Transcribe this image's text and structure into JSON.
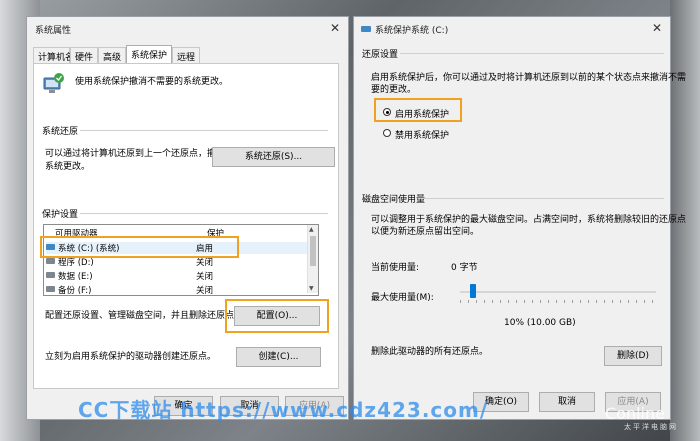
{
  "left_window": {
    "title": "系统属性",
    "tabs": [
      "计算机名",
      "硬件",
      "高级",
      "系统保护",
      "远程"
    ],
    "intro": "使用系统保护撤消不需要的系统更改。",
    "restore_heading": "系统还原",
    "restore_desc_1": "可以通过将计算机还原到上一个还原点，撤消",
    "restore_desc_2": "系统更改。",
    "restore_button": "系统还原(S)...",
    "protection_heading": "保护设置",
    "col_drives": "可用驱动器",
    "col_protection": "保护",
    "drives": [
      {
        "name": "系统 (C:) (系统)",
        "protection": "启用"
      },
      {
        "name": "程序 (D:)",
        "protection": "关闭"
      },
      {
        "name": "数据 (E:)",
        "protection": "关闭"
      },
      {
        "name": "备份 (F:)",
        "protection": "关闭"
      }
    ],
    "config_desc": "配置还原设置、管理磁盘空间，并且删除还原点。",
    "config_button": "配置(O)...",
    "create_desc": "立刻为启用系统保护的驱动器创建还原点。",
    "create_button": "创建(C)...",
    "ok": "确定",
    "cancel": "取消",
    "apply": "应用(A)"
  },
  "right_window": {
    "title": "系统保护系统 (C:)",
    "restore_heading": "还原设置",
    "restore_desc_1": "启用系统保护后，你可以通过及时将计算机还原到以前的某个状态点来撤消不需",
    "restore_desc_2": "要的更改。",
    "radio_on": "启用系统保护",
    "radio_off": "禁用系统保护",
    "disk_heading": "磁盘空间使用量",
    "disk_desc_1": "可以调整用于系统保护的最大磁盘空间。占满空间时，系统将删除较旧的还原点",
    "disk_desc_2": "以便为新还原点留出空间。",
    "current_label": "当前使用量:",
    "current_value": "0 字节",
    "max_label": "最大使用量(M):",
    "slider_fraction": 0.05,
    "max_value": "10% (10.00 GB)",
    "delete_desc": "删除此驱动器的所有还原点。",
    "delete_button": "删除(D)",
    "ok": "确定(O)",
    "cancel": "取消",
    "apply": "应用(A)"
  },
  "watermark": {
    "text": "CC下载站 https://www.cdz423.com/",
    "brand": "Conline",
    "brand_sub": "太平洋电脑网"
  },
  "colors": {
    "highlight": "#f0a21e",
    "accent": "#0078d7"
  }
}
